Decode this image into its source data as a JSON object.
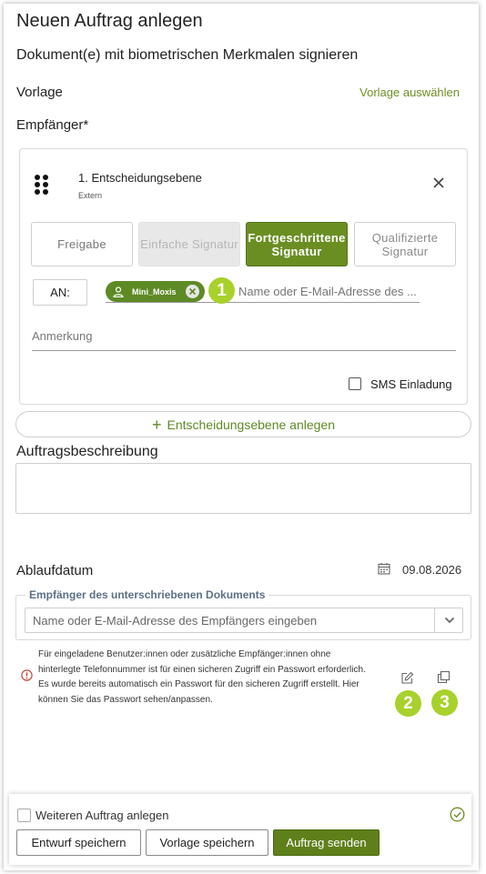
{
  "header": {
    "title": "Neuen Auftrag anlegen",
    "subtitle": "Dokument(e) mit biometrischen Merkmalen signieren"
  },
  "vorlage": {
    "label": "Vorlage",
    "link": "Vorlage auswählen"
  },
  "recipients": {
    "label": "Empfänger*",
    "level": {
      "title": "1. Entscheidungsebene",
      "subtitle": "Extern",
      "signature_types": [
        {
          "label": "Freigabe",
          "state": "available"
        },
        {
          "label": "Einfache Signatur",
          "state": "disabled"
        },
        {
          "label": "Fortgeschrittene Signatur",
          "state": "selected"
        },
        {
          "label": "Qualifizierte Signatur",
          "state": "available"
        }
      ],
      "to_button": "AN:",
      "recipient_chip": "Mini_Moxis",
      "recipient_placeholder": "Name oder E-Mail-Adresse des ...",
      "note_label": "Anmerkung",
      "sms_label": "SMS Einladung"
    },
    "add_level_label": "Entscheidungsebene anlegen"
  },
  "description": {
    "label": "Auftragsbeschreibung",
    "value": ""
  },
  "expiry": {
    "label": "Ablaufdatum",
    "date": "09.08.2026"
  },
  "signed_doc_recipients": {
    "legend": "Empfänger des unterschriebenen Dokuments",
    "placeholder": "Name oder E-Mail-Adresse des Empfängers eingeben"
  },
  "password_notice": "Für eingeladene Benutzer:innen oder zusätzliche Empfänger:innen ohne hinterlegte Telefonnummer ist für einen sicheren Zugriff ein Passwort erforderlich. Es wurde bereits automatisch ein Passwort für den sicheren Zugriff erstellt. Hier können Sie das Passwort sehen/anpassen.",
  "badges": [
    "1",
    "2",
    "3"
  ],
  "footer": {
    "another_order_label": "Weiteren Auftrag anlegen",
    "save_draft": "Entwurf speichern",
    "save_template": "Vorlage speichern",
    "send": "Auftrag senden"
  },
  "colors": {
    "accent": "#6b8e23",
    "badge": "#a8d12c",
    "send_button": "#5e7f1a"
  }
}
